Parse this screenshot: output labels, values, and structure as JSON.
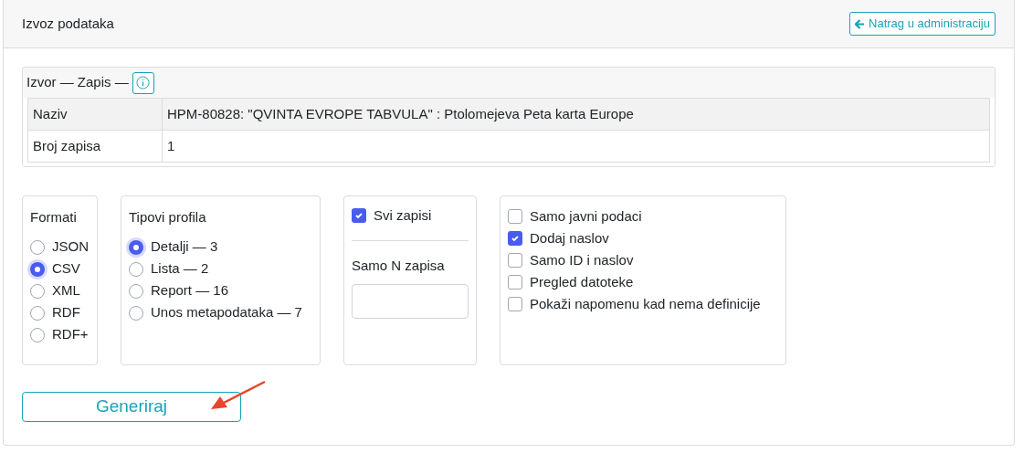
{
  "header": {
    "title": "Izvoz podataka",
    "back_button": "Natrag u administraciju"
  },
  "source": {
    "title": "Izvor — Zapis —",
    "rows": [
      {
        "label": "Naziv",
        "value": "HPM-80828: \"QVINTA EVROPE TABVULA\" : Ptolomejeva Peta karta Europe"
      },
      {
        "label": "Broj zapisa",
        "value": "1"
      }
    ]
  },
  "formats": {
    "title": "Formati",
    "options": [
      {
        "label": "JSON",
        "selected": false
      },
      {
        "label": "CSV",
        "selected": true
      },
      {
        "label": "XML",
        "selected": false
      },
      {
        "label": "RDF",
        "selected": false
      },
      {
        "label": "RDF+",
        "selected": false
      }
    ]
  },
  "profiles": {
    "title": "Tipovi profila",
    "options": [
      {
        "label": "Detalji — 3",
        "selected": true
      },
      {
        "label": "Lista — 2",
        "selected": false
      },
      {
        "label": "Report — 16",
        "selected": false
      },
      {
        "label": "Unos metapodataka — 7",
        "selected": false
      }
    ]
  },
  "records": {
    "all": {
      "label": "Svi zapisi",
      "checked": true
    },
    "limit_label": "Samo N zapisa"
  },
  "settings": [
    {
      "label": "Samo javni podaci",
      "checked": false
    },
    {
      "label": "Dodaj naslov",
      "checked": true
    },
    {
      "label": "Samo ID i naslov",
      "checked": false
    },
    {
      "label": "Pregled datoteke",
      "checked": false
    },
    {
      "label": "Pokaži napomenu kad nema definicije",
      "checked": false
    }
  ],
  "generate_button": "Generiraj"
}
